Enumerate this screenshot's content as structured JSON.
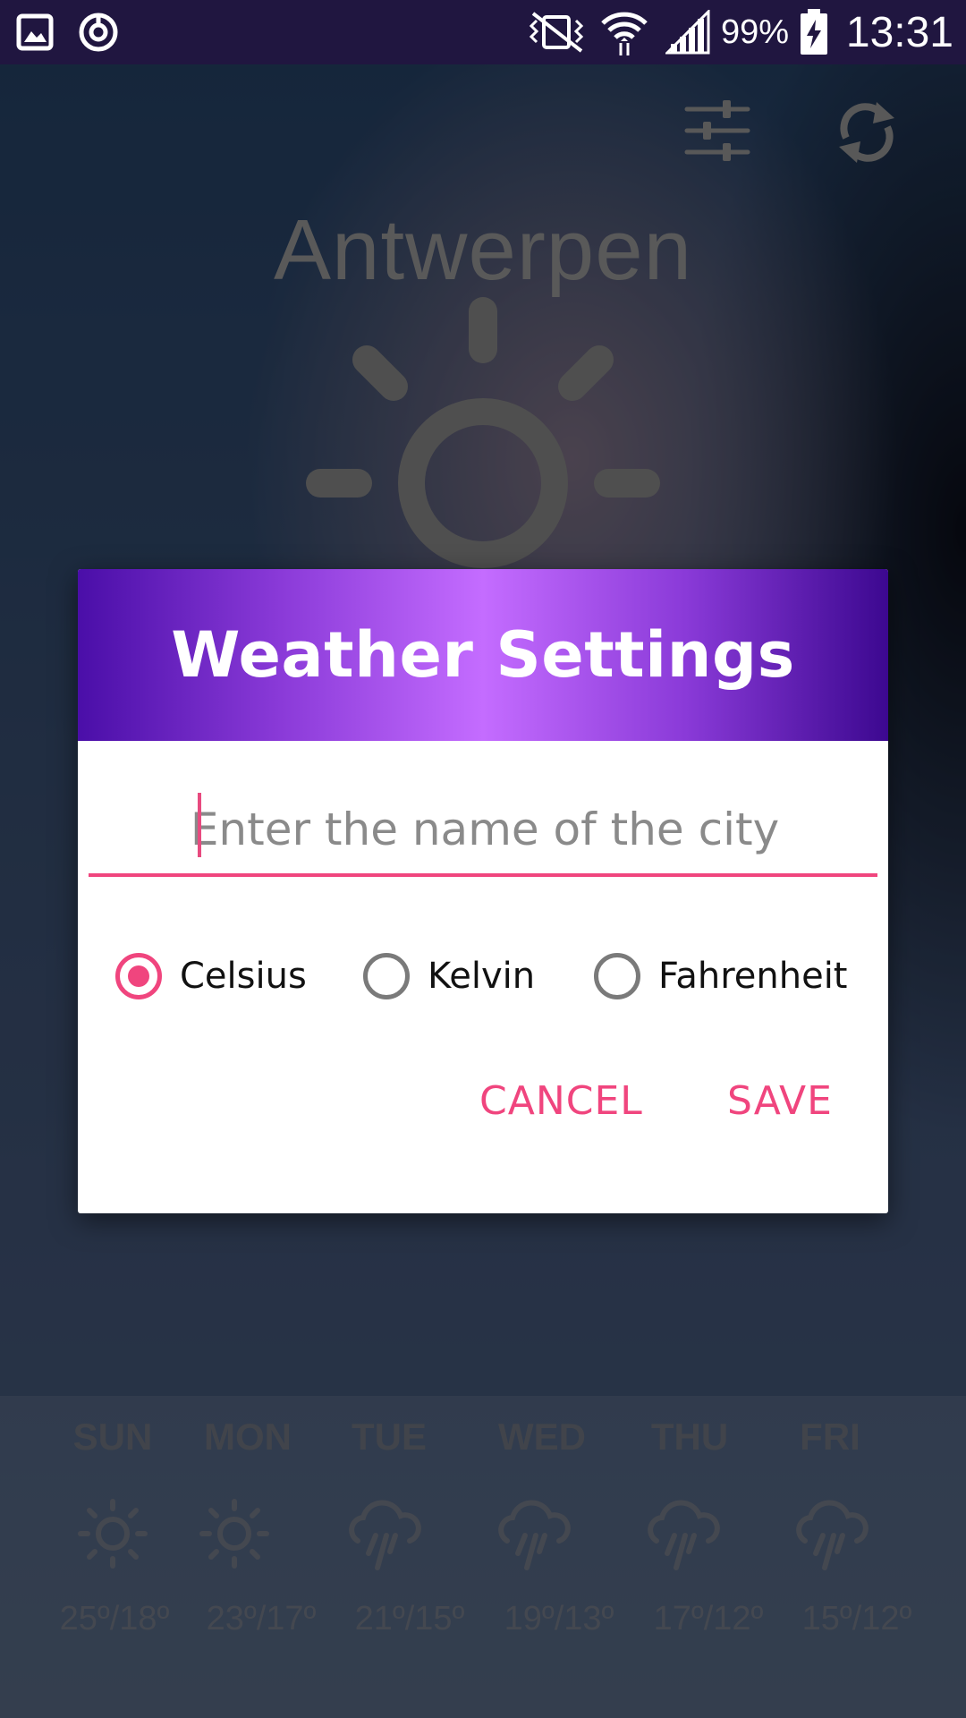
{
  "status_bar": {
    "battery_percent": "99%",
    "time": "13:31",
    "icons": [
      "gallery-icon",
      "sync-icon",
      "vibrate-icon",
      "wifi-icon",
      "signal-icon",
      "battery-charging-icon"
    ]
  },
  "app": {
    "city": "Antwerpen",
    "toolbar_icons": [
      "settings-sliders-icon",
      "refresh-icon"
    ],
    "current_icon": "sun-icon",
    "forecast": [
      {
        "day": "SUN",
        "icon": "sun-icon",
        "temp": "25º/18º"
      },
      {
        "day": "MON",
        "icon": "sun-icon",
        "temp": "23º/17º"
      },
      {
        "day": "TUE",
        "icon": "rain-icon",
        "temp": "21º/15º"
      },
      {
        "day": "WED",
        "icon": "rain-icon",
        "temp": "19º/13º"
      },
      {
        "day": "THU",
        "icon": "rain-icon",
        "temp": "17º/12º"
      },
      {
        "day": "FRI",
        "icon": "rain-icon",
        "temp": "15º/12º"
      }
    ]
  },
  "dialog": {
    "title": "Weather Settings",
    "city_input": {
      "value": "",
      "placeholder": "Enter the name of the city"
    },
    "units": [
      {
        "label": "Celsius",
        "checked": true
      },
      {
        "label": "Kelvin",
        "checked": false
      },
      {
        "label": "Fahrenheit",
        "checked": false
      }
    ],
    "cancel_label": "CANCEL",
    "save_label": "SAVE"
  },
  "colors": {
    "accent": "#f0457e",
    "header_gradient_mid": "#c46cff",
    "header_gradient_edge": "#4a0ea8",
    "status_bar": "#201640"
  }
}
